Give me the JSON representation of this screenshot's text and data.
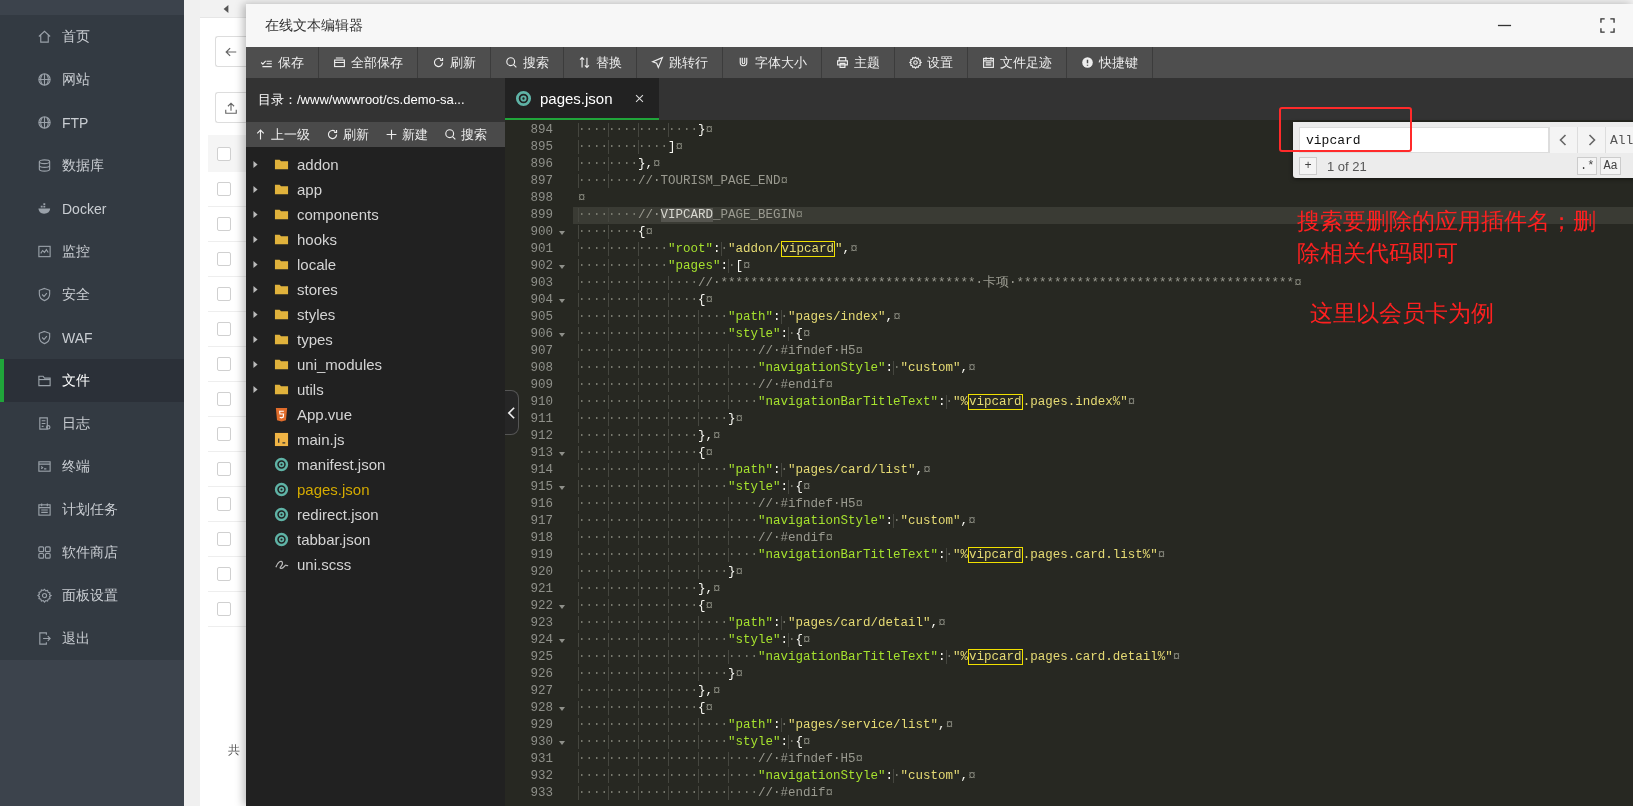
{
  "sidebar": {
    "items": [
      {
        "label": "首页",
        "selected": false
      },
      {
        "label": "网站",
        "selected": false
      },
      {
        "label": "FTP",
        "selected": false
      },
      {
        "label": "数据库",
        "selected": false
      },
      {
        "label": "Docker",
        "selected": false
      },
      {
        "label": "监控",
        "selected": false
      },
      {
        "label": "安全",
        "selected": false
      },
      {
        "label": "WAF",
        "selected": false
      },
      {
        "label": "文件",
        "selected": true
      },
      {
        "label": "日志",
        "selected": false
      },
      {
        "label": "终端",
        "selected": false
      },
      {
        "label": "计划任务",
        "selected": false
      },
      {
        "label": "软件商店",
        "selected": false
      },
      {
        "label": "面板设置",
        "selected": false
      },
      {
        "label": "退出",
        "selected": false
      }
    ]
  },
  "background_page": {
    "header_checked": false,
    "rows": [
      {
        "checked": false
      },
      {
        "checked": false
      },
      {
        "checked": false
      },
      {
        "checked": false
      },
      {
        "checked": false
      },
      {
        "checked": false
      },
      {
        "checked": false
      },
      {
        "checked": false
      },
      {
        "checked": false
      },
      {
        "checked": false
      },
      {
        "checked": false
      },
      {
        "checked": false
      },
      {
        "checked": false
      }
    ],
    "footer": "共"
  },
  "editor": {
    "title": "在线文本编辑器",
    "toolbar": [
      "保存",
      "全部保存",
      "刷新",
      "搜索",
      "替换",
      "跳转行",
      "字体大小",
      "主题",
      "设置",
      "文件足迹",
      "快捷键"
    ],
    "directory": "目录：/www/wwwroot/cs.demo-sa...",
    "tree_actions": [
      "上一级",
      "刷新",
      "新建",
      "搜索"
    ],
    "tree": [
      {
        "name": "addon",
        "kind": "folder",
        "expanded": false,
        "selected": false
      },
      {
        "name": "app",
        "kind": "folder",
        "expanded": false,
        "selected": false
      },
      {
        "name": "components",
        "kind": "folder",
        "expanded": false,
        "selected": false
      },
      {
        "name": "hooks",
        "kind": "folder",
        "expanded": false,
        "selected": false
      },
      {
        "name": "locale",
        "kind": "folder",
        "expanded": false,
        "selected": false
      },
      {
        "name": "stores",
        "kind": "folder",
        "expanded": false,
        "selected": false
      },
      {
        "name": "styles",
        "kind": "folder",
        "expanded": false,
        "selected": false
      },
      {
        "name": "types",
        "kind": "folder",
        "expanded": false,
        "selected": false
      },
      {
        "name": "uni_modules",
        "kind": "folder",
        "expanded": false,
        "selected": false
      },
      {
        "name": "utils",
        "kind": "folder",
        "expanded": false,
        "selected": false
      },
      {
        "name": "App.vue",
        "kind": "html",
        "selected": false
      },
      {
        "name": "main.js",
        "kind": "js",
        "selected": false
      },
      {
        "name": "manifest.json",
        "kind": "json",
        "selected": false
      },
      {
        "name": "pages.json",
        "kind": "json",
        "selected": true
      },
      {
        "name": "redirect.json",
        "kind": "json",
        "selected": false
      },
      {
        "name": "tabbar.json",
        "kind": "json",
        "selected": false
      },
      {
        "name": "uni.scss",
        "kind": "scss",
        "selected": false
      }
    ],
    "tabs": [
      {
        "label": "pages.json",
        "selected": true
      }
    ],
    "lines": [
      {
        "no": "894",
        "fold": false,
        "current": false,
        "segs": [
          {
            "kind": "ws",
            "text": "················"
          },
          {
            "kind": "punct",
            "text": "}"
          },
          {
            "kind": "eol",
            "text": "¤"
          }
        ]
      },
      {
        "no": "895",
        "fold": false,
        "current": false,
        "segs": [
          {
            "kind": "ws",
            "text": "············"
          },
          {
            "kind": "punct",
            "text": "]"
          },
          {
            "kind": "eol",
            "text": "¤"
          }
        ]
      },
      {
        "no": "896",
        "fold": false,
        "current": false,
        "segs": [
          {
            "kind": "ws",
            "text": "········"
          },
          {
            "kind": "punct",
            "text": "},"
          },
          {
            "kind": "eol",
            "text": "¤"
          }
        ]
      },
      {
        "no": "897",
        "fold": false,
        "current": false,
        "segs": [
          {
            "kind": "ws",
            "text": "········"
          },
          {
            "kind": "comment",
            "text": "//·TOURISM_PAGE_END"
          },
          {
            "kind": "eol",
            "text": "¤"
          }
        ]
      },
      {
        "no": "898",
        "fold": false,
        "current": false,
        "segs": [
          {
            "kind": "eol",
            "text": "¤"
          }
        ]
      },
      {
        "no": "899",
        "fold": false,
        "current": true,
        "segs": [
          {
            "kind": "ws",
            "text": "········"
          },
          {
            "kind": "comment",
            "text": "//·"
          },
          {
            "kind": "selection",
            "text": "VIPCARD"
          },
          {
            "kind": "comment",
            "text": "_PAGE_BEGIN"
          },
          {
            "kind": "eol",
            "text": "¤"
          }
        ]
      },
      {
        "no": "900",
        "fold": true,
        "current": false,
        "segs": [
          {
            "kind": "ws",
            "text": "········"
          },
          {
            "kind": "punct",
            "text": "{"
          },
          {
            "kind": "eol",
            "text": "¤"
          }
        ]
      },
      {
        "no": "901",
        "fold": false,
        "current": false,
        "segs": [
          {
            "kind": "ws",
            "text": "············"
          },
          {
            "kind": "key",
            "text": "\"root\""
          },
          {
            "kind": "punct",
            "text": ":"
          },
          {
            "kind": "ws",
            "text": "·"
          },
          {
            "kind": "string",
            "text": "\"addon/"
          },
          {
            "kind": "match",
            "text": "vipcard"
          },
          {
            "kind": "string",
            "text": "\""
          },
          {
            "kind": "punct",
            "text": ","
          },
          {
            "kind": "eol",
            "text": "¤"
          }
        ]
      },
      {
        "no": "902",
        "fold": true,
        "current": false,
        "segs": [
          {
            "kind": "ws",
            "text": "············"
          },
          {
            "kind": "key",
            "text": "\"pages\""
          },
          {
            "kind": "punct",
            "text": ":"
          },
          {
            "kind": "ws",
            "text": "·"
          },
          {
            "kind": "punct",
            "text": "["
          },
          {
            "kind": "eol",
            "text": "¤"
          }
        ]
      },
      {
        "no": "903",
        "fold": false,
        "current": false,
        "segs": [
          {
            "kind": "ws",
            "text": "················"
          },
          {
            "kind": "comment",
            "text": "//·**********************************·卡项·*************************************"
          },
          {
            "kind": "eol",
            "text": "¤"
          }
        ]
      },
      {
        "no": "904",
        "fold": true,
        "current": false,
        "segs": [
          {
            "kind": "ws",
            "text": "················"
          },
          {
            "kind": "punct",
            "text": "{"
          },
          {
            "kind": "eol",
            "text": "¤"
          }
        ]
      },
      {
        "no": "905",
        "fold": false,
        "current": false,
        "segs": [
          {
            "kind": "ws",
            "text": "····················"
          },
          {
            "kind": "key",
            "text": "\"path\""
          },
          {
            "kind": "punct",
            "text": ":"
          },
          {
            "kind": "ws",
            "text": "·"
          },
          {
            "kind": "string",
            "text": "\"pages/index\""
          },
          {
            "kind": "punct",
            "text": ","
          },
          {
            "kind": "eol",
            "text": "¤"
          }
        ]
      },
      {
        "no": "906",
        "fold": true,
        "current": false,
        "segs": [
          {
            "kind": "ws",
            "text": "····················"
          },
          {
            "kind": "key",
            "text": "\"style\""
          },
          {
            "kind": "punct",
            "text": ":"
          },
          {
            "kind": "ws",
            "text": "·"
          },
          {
            "kind": "punct",
            "text": "{"
          },
          {
            "kind": "eol",
            "text": "¤"
          }
        ]
      },
      {
        "no": "907",
        "fold": false,
        "current": false,
        "segs": [
          {
            "kind": "ws",
            "text": "························"
          },
          {
            "kind": "comment",
            "text": "//·#ifndef·H5"
          },
          {
            "kind": "eol",
            "text": "¤"
          }
        ]
      },
      {
        "no": "908",
        "fold": false,
        "current": false,
        "segs": [
          {
            "kind": "ws",
            "text": "························"
          },
          {
            "kind": "key",
            "text": "\"navigationStyle\""
          },
          {
            "kind": "punct",
            "text": ":"
          },
          {
            "kind": "ws",
            "text": "·"
          },
          {
            "kind": "string",
            "text": "\"custom\""
          },
          {
            "kind": "punct",
            "text": ","
          },
          {
            "kind": "eol",
            "text": "¤"
          }
        ]
      },
      {
        "no": "909",
        "fold": false,
        "current": false,
        "segs": [
          {
            "kind": "ws",
            "text": "························"
          },
          {
            "kind": "comment",
            "text": "//·#endif"
          },
          {
            "kind": "eol",
            "text": "¤"
          }
        ]
      },
      {
        "no": "910",
        "fold": false,
        "current": false,
        "segs": [
          {
            "kind": "ws",
            "text": "························"
          },
          {
            "kind": "key",
            "text": "\"navigationBarTitleText\""
          },
          {
            "kind": "punct",
            "text": ":"
          },
          {
            "kind": "ws",
            "text": "·"
          },
          {
            "kind": "string",
            "text": "\"%"
          },
          {
            "kind": "match",
            "text": "vipcard"
          },
          {
            "kind": "string",
            "text": ".pages.index%\""
          },
          {
            "kind": "eol",
            "text": "¤"
          }
        ]
      },
      {
        "no": "911",
        "fold": false,
        "current": false,
        "segs": [
          {
            "kind": "ws",
            "text": "····················"
          },
          {
            "kind": "punct",
            "text": "}"
          },
          {
            "kind": "eol",
            "text": "¤"
          }
        ]
      },
      {
        "no": "912",
        "fold": false,
        "current": false,
        "segs": [
          {
            "kind": "ws",
            "text": "················"
          },
          {
            "kind": "punct",
            "text": "},"
          },
          {
            "kind": "eol",
            "text": "¤"
          }
        ]
      },
      {
        "no": "913",
        "fold": true,
        "current": false,
        "segs": [
          {
            "kind": "ws",
            "text": "················"
          },
          {
            "kind": "punct",
            "text": "{"
          },
          {
            "kind": "eol",
            "text": "¤"
          }
        ]
      },
      {
        "no": "914",
        "fold": false,
        "current": false,
        "segs": [
          {
            "kind": "ws",
            "text": "····················"
          },
          {
            "kind": "key",
            "text": "\"path\""
          },
          {
            "kind": "punct",
            "text": ":"
          },
          {
            "kind": "ws",
            "text": "·"
          },
          {
            "kind": "string",
            "text": "\"pages/card/list\""
          },
          {
            "kind": "punct",
            "text": ","
          },
          {
            "kind": "eol",
            "text": "¤"
          }
        ]
      },
      {
        "no": "915",
        "fold": true,
        "current": false,
        "segs": [
          {
            "kind": "ws",
            "text": "····················"
          },
          {
            "kind": "key",
            "text": "\"style\""
          },
          {
            "kind": "punct",
            "text": ":"
          },
          {
            "kind": "ws",
            "text": "·"
          },
          {
            "kind": "punct",
            "text": "{"
          },
          {
            "kind": "eol",
            "text": "¤"
          }
        ]
      },
      {
        "no": "916",
        "fold": false,
        "current": false,
        "segs": [
          {
            "kind": "ws",
            "text": "························"
          },
          {
            "kind": "comment",
            "text": "//·#ifndef·H5"
          },
          {
            "kind": "eol",
            "text": "¤"
          }
        ]
      },
      {
        "no": "917",
        "fold": false,
        "current": false,
        "segs": [
          {
            "kind": "ws",
            "text": "························"
          },
          {
            "kind": "key",
            "text": "\"navigationStyle\""
          },
          {
            "kind": "punct",
            "text": ":"
          },
          {
            "kind": "ws",
            "text": "·"
          },
          {
            "kind": "string",
            "text": "\"custom\""
          },
          {
            "kind": "punct",
            "text": ","
          },
          {
            "kind": "eol",
            "text": "¤"
          }
        ]
      },
      {
        "no": "918",
        "fold": false,
        "current": false,
        "segs": [
          {
            "kind": "ws",
            "text": "························"
          },
          {
            "kind": "comment",
            "text": "//·#endif"
          },
          {
            "kind": "eol",
            "text": "¤"
          }
        ]
      },
      {
        "no": "919",
        "fold": false,
        "current": false,
        "segs": [
          {
            "kind": "ws",
            "text": "························"
          },
          {
            "kind": "key",
            "text": "\"navigationBarTitleText\""
          },
          {
            "kind": "punct",
            "text": ":"
          },
          {
            "kind": "ws",
            "text": "·"
          },
          {
            "kind": "string",
            "text": "\"%"
          },
          {
            "kind": "match",
            "text": "vipcard"
          },
          {
            "kind": "string",
            "text": ".pages.card.list%\""
          },
          {
            "kind": "eol",
            "text": "¤"
          }
        ]
      },
      {
        "no": "920",
        "fold": false,
        "current": false,
        "segs": [
          {
            "kind": "ws",
            "text": "····················"
          },
          {
            "kind": "punct",
            "text": "}"
          },
          {
            "kind": "eol",
            "text": "¤"
          }
        ]
      },
      {
        "no": "921",
        "fold": false,
        "current": false,
        "segs": [
          {
            "kind": "ws",
            "text": "················"
          },
          {
            "kind": "punct",
            "text": "},"
          },
          {
            "kind": "eol",
            "text": "¤"
          }
        ]
      },
      {
        "no": "922",
        "fold": true,
        "current": false,
        "segs": [
          {
            "kind": "ws",
            "text": "················"
          },
          {
            "kind": "punct",
            "text": "{"
          },
          {
            "kind": "eol",
            "text": "¤"
          }
        ]
      },
      {
        "no": "923",
        "fold": false,
        "current": false,
        "segs": [
          {
            "kind": "ws",
            "text": "····················"
          },
          {
            "kind": "key",
            "text": "\"path\""
          },
          {
            "kind": "punct",
            "text": ":"
          },
          {
            "kind": "ws",
            "text": "·"
          },
          {
            "kind": "string",
            "text": "\"pages/card/detail\""
          },
          {
            "kind": "punct",
            "text": ","
          },
          {
            "kind": "eol",
            "text": "¤"
          }
        ]
      },
      {
        "no": "924",
        "fold": true,
        "current": false,
        "segs": [
          {
            "kind": "ws",
            "text": "····················"
          },
          {
            "kind": "key",
            "text": "\"style\""
          },
          {
            "kind": "punct",
            "text": ":"
          },
          {
            "kind": "ws",
            "text": "·"
          },
          {
            "kind": "punct",
            "text": "{"
          },
          {
            "kind": "eol",
            "text": "¤"
          }
        ]
      },
      {
        "no": "925",
        "fold": false,
        "current": false,
        "segs": [
          {
            "kind": "ws",
            "text": "························"
          },
          {
            "kind": "key",
            "text": "\"navigationBarTitleText\""
          },
          {
            "kind": "punct",
            "text": ":"
          },
          {
            "kind": "ws",
            "text": "·"
          },
          {
            "kind": "string",
            "text": "\"%"
          },
          {
            "kind": "match",
            "text": "vipcard"
          },
          {
            "kind": "string",
            "text": ".pages.card.detail%\""
          },
          {
            "kind": "eol",
            "text": "¤"
          }
        ]
      },
      {
        "no": "926",
        "fold": false,
        "current": false,
        "segs": [
          {
            "kind": "ws",
            "text": "····················"
          },
          {
            "kind": "punct",
            "text": "}"
          },
          {
            "kind": "eol",
            "text": "¤"
          }
        ]
      },
      {
        "no": "927",
        "fold": false,
        "current": false,
        "segs": [
          {
            "kind": "ws",
            "text": "················"
          },
          {
            "kind": "punct",
            "text": "},"
          },
          {
            "kind": "eol",
            "text": "¤"
          }
        ]
      },
      {
        "no": "928",
        "fold": true,
        "current": false,
        "segs": [
          {
            "kind": "ws",
            "text": "················"
          },
          {
            "kind": "punct",
            "text": "{"
          },
          {
            "kind": "eol",
            "text": "¤"
          }
        ]
      },
      {
        "no": "929",
        "fold": false,
        "current": false,
        "segs": [
          {
            "kind": "ws",
            "text": "····················"
          },
          {
            "kind": "key",
            "text": "\"path\""
          },
          {
            "kind": "punct",
            "text": ":"
          },
          {
            "kind": "ws",
            "text": "·"
          },
          {
            "kind": "string",
            "text": "\"pages/service/list\""
          },
          {
            "kind": "punct",
            "text": ","
          },
          {
            "kind": "eol",
            "text": "¤"
          }
        ]
      },
      {
        "no": "930",
        "fold": true,
        "current": false,
        "segs": [
          {
            "kind": "ws",
            "text": "····················"
          },
          {
            "kind": "key",
            "text": "\"style\""
          },
          {
            "kind": "punct",
            "text": ":"
          },
          {
            "kind": "ws",
            "text": "·"
          },
          {
            "kind": "punct",
            "text": "{"
          },
          {
            "kind": "eol",
            "text": "¤"
          }
        ]
      },
      {
        "no": "931",
        "fold": false,
        "current": false,
        "segs": [
          {
            "kind": "ws",
            "text": "························"
          },
          {
            "kind": "comment",
            "text": "//·#ifndef·H5"
          },
          {
            "kind": "eol",
            "text": "¤"
          }
        ]
      },
      {
        "no": "932",
        "fold": false,
        "current": false,
        "segs": [
          {
            "kind": "ws",
            "text": "························"
          },
          {
            "kind": "key",
            "text": "\"navigationStyle\""
          },
          {
            "kind": "punct",
            "text": ":"
          },
          {
            "kind": "ws",
            "text": "·"
          },
          {
            "kind": "string",
            "text": "\"custom\""
          },
          {
            "kind": "punct",
            "text": ","
          },
          {
            "kind": "eol",
            "text": "¤"
          }
        ]
      },
      {
        "no": "933",
        "fold": false,
        "current": false,
        "segs": [
          {
            "kind": "ws",
            "text": "························"
          },
          {
            "kind": "comment",
            "text": "//·#endif"
          },
          {
            "kind": "eol",
            "text": "¤"
          }
        ]
      }
    ],
    "find": {
      "value": "vipcard",
      "all_label": "All",
      "add_label": "+",
      "count": "1 of 21",
      "regex_label": ".*",
      "case_label": "Aa"
    }
  },
  "annotations": [
    {
      "text": "搜索要删除的应用插件名；删除相关代码即可"
    },
    {
      "text": "这里以会员卡为例"
    }
  ]
}
